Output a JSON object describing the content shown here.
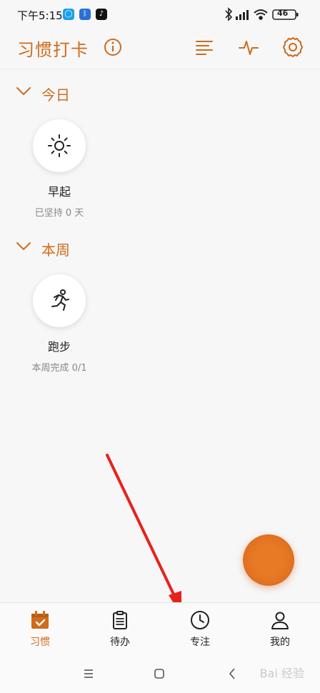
{
  "status_bar": {
    "time": "下午5:15",
    "battery": "46"
  },
  "header": {
    "title": "习惯打卡"
  },
  "sections": [
    {
      "title": "今日",
      "habits": [
        {
          "name": "早起",
          "subtitle": "已坚持 0 天",
          "icon": "sun-icon"
        }
      ]
    },
    {
      "title": "本周",
      "habits": [
        {
          "name": "跑步",
          "subtitle": "本周完成 0/1",
          "icon": "running-icon"
        }
      ]
    }
  ],
  "bottom_nav": {
    "items": [
      {
        "label": "习惯",
        "icon": "calendar-check-icon",
        "active": true
      },
      {
        "label": "待办",
        "icon": "clipboard-icon",
        "active": false
      },
      {
        "label": "专注",
        "icon": "clock-icon",
        "active": false
      },
      {
        "label": "我的",
        "icon": "person-icon",
        "active": false
      }
    ]
  },
  "colors": {
    "accent": "#cf6b1c",
    "arrow": "#e8211b",
    "fab": "#e87a26"
  }
}
